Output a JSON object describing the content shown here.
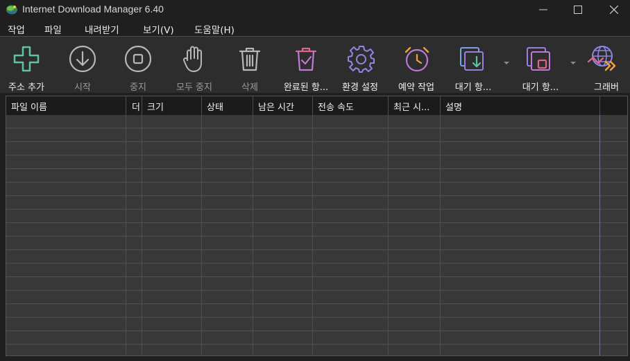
{
  "window": {
    "title": "Internet Download Manager 6.40"
  },
  "menu": [
    "작업",
    "파일",
    "내려받기",
    "보기(V)",
    "도움말(H)"
  ],
  "toolbar": [
    {
      "id": "add-url",
      "label": "주소 추가",
      "enabled": true,
      "icon": "plus-icon"
    },
    {
      "id": "start",
      "label": "시작",
      "enabled": false,
      "icon": "download-arrow-icon"
    },
    {
      "id": "stop",
      "label": "중지",
      "enabled": false,
      "icon": "stop-icon"
    },
    {
      "id": "stop-all",
      "label": "모두 중지",
      "enabled": false,
      "icon": "hand-icon"
    },
    {
      "id": "delete",
      "label": "삭제",
      "enabled": false,
      "icon": "trash-icon"
    },
    {
      "id": "delete-completed",
      "label": "완료된 항...",
      "enabled": true,
      "icon": "trash-check-icon"
    },
    {
      "id": "options",
      "label": "환경 설정",
      "enabled": true,
      "icon": "gear-icon"
    },
    {
      "id": "scheduler",
      "label": "예약 작업",
      "enabled": true,
      "icon": "alarm-clock-icon"
    },
    {
      "id": "start-queue",
      "label": "대기 항...",
      "enabled": true,
      "icon": "queue-download-icon"
    },
    {
      "id": "stop-queue",
      "label": "대기 항...",
      "enabled": true,
      "icon": "queue-stop-icon"
    },
    {
      "id": "grabber",
      "label": "그래버",
      "enabled": true,
      "icon": "globe-arrow-icon"
    }
  ],
  "columns": [
    "파일 이름",
    "더",
    "크기",
    "상태",
    "남은 시간",
    "전송 속도",
    "최근 시...",
    "설명"
  ],
  "colors": {
    "accent_green": "#5fc4a6",
    "accent_pink": "#e0648c",
    "accent_purple": "#9b7fe0",
    "accent_orange": "#f2a03c",
    "disabled": "#9a9a9a"
  }
}
